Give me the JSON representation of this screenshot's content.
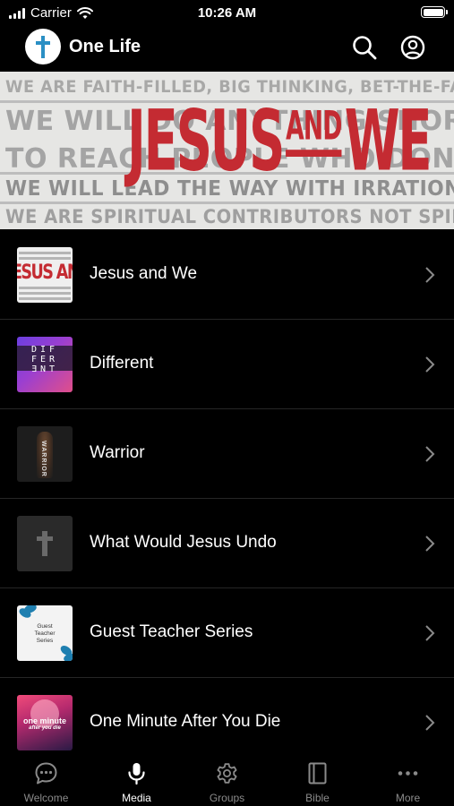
{
  "status_bar": {
    "carrier": "Carrier",
    "time": "10:26 AM"
  },
  "header": {
    "title": "One Life"
  },
  "banner": {
    "lines": [
      "WE ARE FAITH-FILLED, BIG THINKING, BET-THE-FARM RISK TAKERS.",
      "WE WILL DO ANYTHING SHORT OF SIN",
      "TO REACH PEOPLE WHO DON'T KNOW CHRIST.",
      "WE WILL LEAD THE WAY WITH IRRATIONAL GENEROSITY.",
      "WE ARE SPIRITUAL CONTRIBUTORS NOT SPIRITUAL CONSUMERS."
    ],
    "title_left": "JESUS",
    "title_and": "AND",
    "title_right": "WE"
  },
  "media_list": [
    {
      "label": "Jesus and We",
      "thumb_text": "ESUS AN"
    },
    {
      "label": "Different",
      "thumb_text": [
        "DIF",
        "FER",
        "ƎNT"
      ]
    },
    {
      "label": "Warrior",
      "thumb_text": "WARRIOR"
    },
    {
      "label": "What Would Jesus Undo"
    },
    {
      "label": "Guest Teacher Series",
      "thumb_text": "Guest Teacher Series"
    },
    {
      "label": "One Minute After You Die",
      "thumb_text": [
        "one minute",
        "after you die"
      ]
    }
  ],
  "tabs": [
    {
      "label": "Welcome",
      "icon": "chat-bubble-icon",
      "active": false
    },
    {
      "label": "Media",
      "icon": "microphone-icon",
      "active": true
    },
    {
      "label": "Groups",
      "icon": "gear-icon",
      "active": false
    },
    {
      "label": "Bible",
      "icon": "book-icon",
      "active": false
    },
    {
      "label": "More",
      "icon": "more-dots-icon",
      "active": false
    }
  ],
  "colors": {
    "background": "#000000",
    "accent_red": "#c42b32",
    "inactive_tab": "#8a8a8a",
    "divider": "#262626"
  }
}
